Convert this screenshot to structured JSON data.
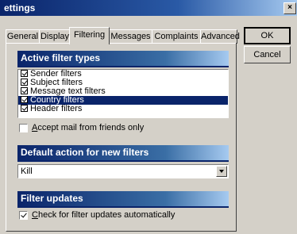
{
  "window": {
    "title": "ettings",
    "close_glyph": "×"
  },
  "tabs": [
    "General",
    "Display",
    "Filtering",
    "Messages",
    "Complaints",
    "Advanced"
  ],
  "active_tab": "Filtering",
  "buttons": {
    "ok": "OK",
    "cancel": "Cancel"
  },
  "sections": {
    "active_filters": {
      "title": "Active filter types",
      "items": [
        {
          "label": "Sender filters",
          "checked": true,
          "selected": false
        },
        {
          "label": "Subject filters",
          "checked": true,
          "selected": false
        },
        {
          "label": "Message text filters",
          "checked": true,
          "selected": false
        },
        {
          "label": "Country filters",
          "checked": true,
          "selected": true
        },
        {
          "label": "Header filters",
          "checked": true,
          "selected": false
        }
      ],
      "accept_friends": {
        "label_first": "A",
        "label_rest": "ccept mail from friends only",
        "checked": false
      }
    },
    "default_action": {
      "title": "Default action for new filters",
      "value": "Kill"
    },
    "filter_updates": {
      "title": "Filter updates",
      "check_updates": {
        "label_first": "C",
        "label_rest": "heck for filter updates automatically",
        "checked": true
      }
    }
  },
  "colors": {
    "header_bg": "#0a246a",
    "face": "#d4d0c8",
    "selection": "#0a246a"
  }
}
